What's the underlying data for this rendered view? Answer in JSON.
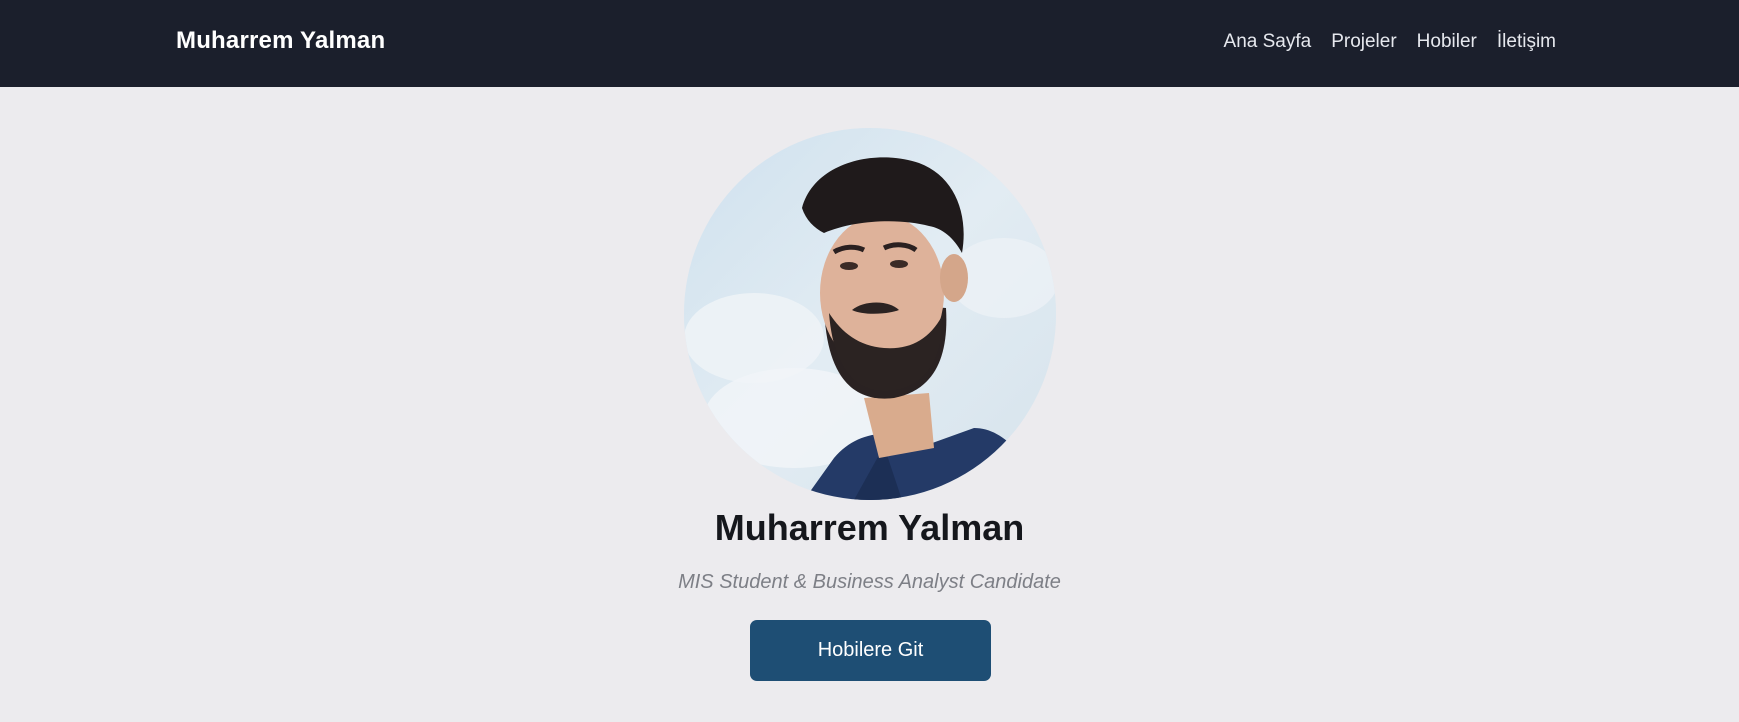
{
  "navbar": {
    "brand": "Muharrem Yalman",
    "links": [
      {
        "label": "Ana Sayfa"
      },
      {
        "label": "Projeler"
      },
      {
        "label": "Hobiler"
      },
      {
        "label": "İletişim"
      }
    ]
  },
  "hero": {
    "avatar_alt": "profile-photo",
    "name": "Muharrem Yalman",
    "subtitle": "MIS Student & Business Analyst Candidate",
    "cta_label": "Hobilere Git"
  },
  "colors": {
    "navbar_bg": "#1b1f2c",
    "page_bg": "#ecebee",
    "button_bg": "#1e4e74"
  }
}
